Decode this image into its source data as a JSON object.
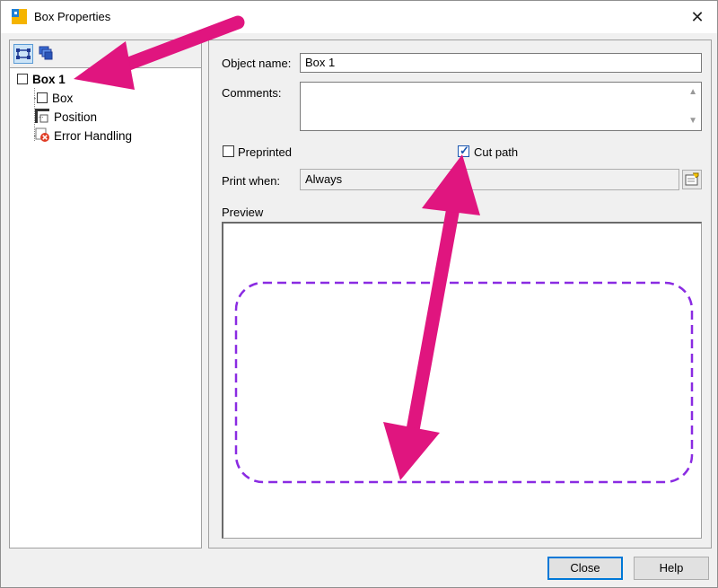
{
  "window": {
    "title": "Box Properties",
    "close_glyph": "✕"
  },
  "left_toolbar": {
    "buttons": [
      {
        "icon": "shape-icon",
        "active": true
      },
      {
        "icon": "layers-icon",
        "active": false
      }
    ]
  },
  "tree": {
    "root": {
      "label": "Box 1"
    },
    "children": [
      {
        "label": "Box",
        "icon": "box-icon"
      },
      {
        "label": "Position",
        "icon": "position-icon"
      },
      {
        "label": "Error Handling",
        "icon": "error-handling-icon"
      }
    ]
  },
  "form": {
    "object_name_label": "Object name:",
    "object_name_value": "Box 1",
    "comments_label": "Comments:",
    "comments_value": "",
    "preprinted_label": "Preprinted",
    "preprinted_checked": false,
    "cut_path_label": "Cut path",
    "cut_path_checked": true,
    "print_when_label": "Print when:",
    "print_when_value": "Always",
    "preview_label": "Preview"
  },
  "buttons": {
    "close": "Close",
    "help": "Help"
  },
  "colors": {
    "annotation_arrow": "#e0157f",
    "cut_path_stroke": "#8a2be2",
    "focus_border": "#0078d7"
  }
}
